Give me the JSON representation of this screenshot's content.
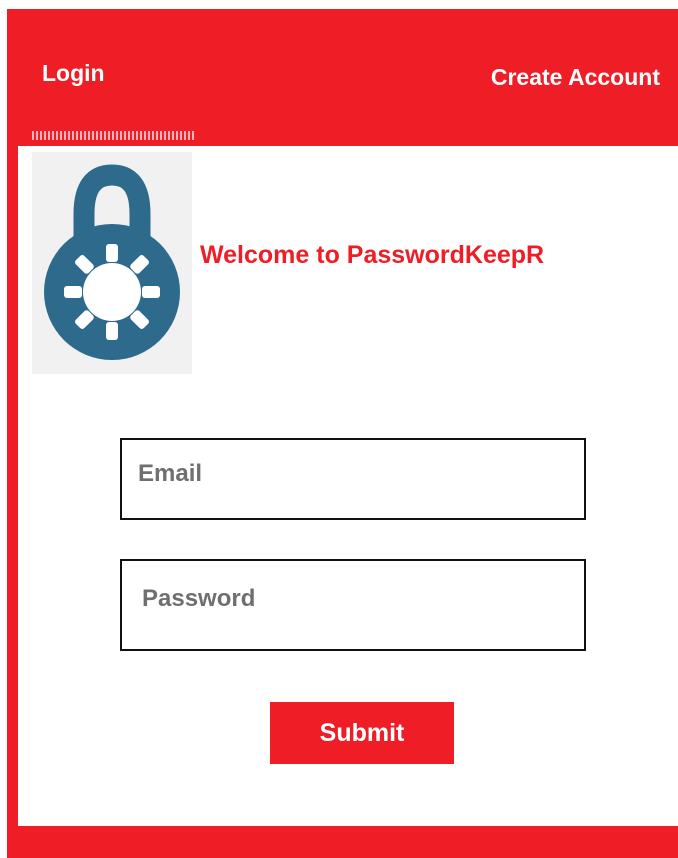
{
  "nav": {
    "login_label": "Login",
    "create_account_label": "Create Account"
  },
  "branding": {
    "welcome_text": "Welcome to PasswordKeepR",
    "logo_icon": "padlock-icon"
  },
  "form": {
    "email_placeholder": "Email",
    "password_placeholder": "Password",
    "submit_label": "Submit"
  },
  "colors": {
    "brand_red": "#ee1d26",
    "lock_blue": "#2d6a8c",
    "text_white": "#ffffff"
  }
}
